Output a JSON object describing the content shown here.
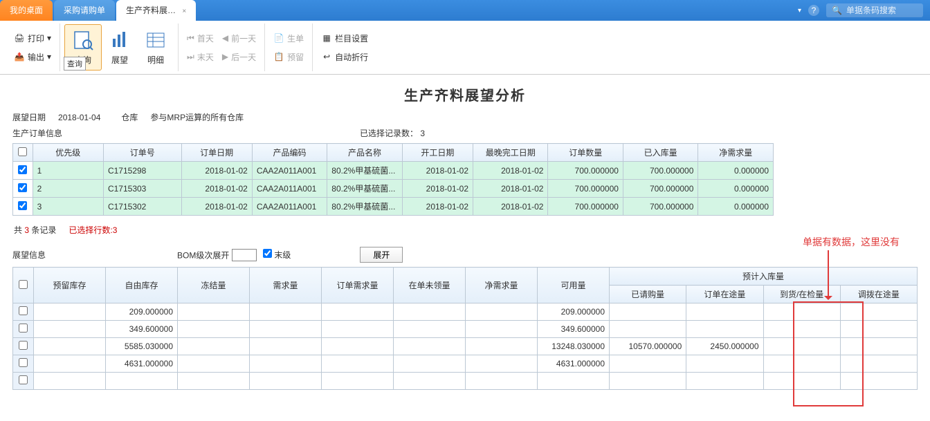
{
  "topbar": {
    "tabs": [
      {
        "label": "我的桌面"
      },
      {
        "label": "采购请购单"
      },
      {
        "label": "生产齐料展…",
        "close": "×"
      }
    ],
    "help_icon": "?",
    "search_placeholder": "单据条码搜索"
  },
  "ribbon": {
    "print": "打印",
    "output": "输出",
    "query": "查询",
    "query_tooltip": "查询",
    "outlook": "展望",
    "detail": "明细",
    "first_day": "首天",
    "prev_day": "前一天",
    "last_day": "末天",
    "next_day": "后一天",
    "prod_order": "生单",
    "reserve": "预留",
    "column_setting": "栏目设置",
    "auto_wrap": "自动折行"
  },
  "page": {
    "title": "生产齐料展望分析",
    "outlook_date_label": "展望日期",
    "outlook_date": "2018-01-04",
    "warehouse_label": "仓库",
    "warehouse": "参与MRP运算的所有仓库",
    "order_info_label": "生产订单信息",
    "selected_count_label": "已选择记录数：",
    "selected_count": "3"
  },
  "table1": {
    "headers": {
      "priority": "优先级",
      "order_no": "订单号",
      "order_date": "订单日期",
      "prod_code": "产品编码",
      "prod_name": "产品名称",
      "start_date": "开工日期",
      "latest_finish": "最晚完工日期",
      "order_qty": "订单数量",
      "in_stock": "已入库量",
      "net_demand": "净需求量"
    },
    "rows": [
      {
        "priority": "1",
        "order_no": "C1715298",
        "order_date": "2018-01-02",
        "prod_code": "CAA2A011A001",
        "prod_name": "80.2%甲基硫菌...",
        "start_date": "2018-01-02",
        "latest_finish": "2018-01-02",
        "order_qty": "700.000000",
        "in_stock": "700.000000",
        "net_demand": "0.000000"
      },
      {
        "priority": "2",
        "order_no": "C1715303",
        "order_date": "2018-01-02",
        "prod_code": "CAA2A011A001",
        "prod_name": "80.2%甲基硫菌...",
        "start_date": "2018-01-02",
        "latest_finish": "2018-01-02",
        "order_qty": "700.000000",
        "in_stock": "700.000000",
        "net_demand": "0.000000"
      },
      {
        "priority": "3",
        "order_no": "C1715302",
        "order_date": "2018-01-02",
        "prod_code": "CAA2A011A001",
        "prod_name": "80.2%甲基硫菌...",
        "start_date": "2018-01-02",
        "latest_finish": "2018-01-02",
        "order_qty": "700.000000",
        "in_stock": "700.000000",
        "net_demand": "0.000000"
      }
    ]
  },
  "summary": {
    "total_prefix": "共",
    "total_count": "3",
    "total_suffix": "条记录",
    "selected_rows": "已选择行数:3"
  },
  "section2": {
    "outlook_info": "展望信息",
    "bom_level": "BOM级次展开",
    "leaf": "末级",
    "expand": "展开"
  },
  "table2": {
    "headers": {
      "reserved_stock": "预留库存",
      "free_stock": "自由库存",
      "frozen_qty": "冻结量",
      "demand_qty": "需求量",
      "order_demand": "订单需求量",
      "in_order_unrecv": "在单未领量",
      "net_demand": "净需求量",
      "available": "可用量",
      "expected_in": "预计入库量",
      "purchased": "已请购量",
      "order_transit": "订单在途量",
      "arrival_inspect": "到货/在检量",
      "transfer_transit": "调拨在途量"
    },
    "rows": [
      {
        "free_stock": "209.000000",
        "available": "209.000000"
      },
      {
        "free_stock": "349.600000",
        "available": "349.600000"
      },
      {
        "free_stock": "5585.030000",
        "available": "13248.030000",
        "purchased": "10570.000000",
        "order_transit": "2450.000000"
      },
      {
        "free_stock": "4631.000000",
        "available": "4631.000000"
      },
      {}
    ]
  },
  "annotation": "单据有数据，这里没有"
}
